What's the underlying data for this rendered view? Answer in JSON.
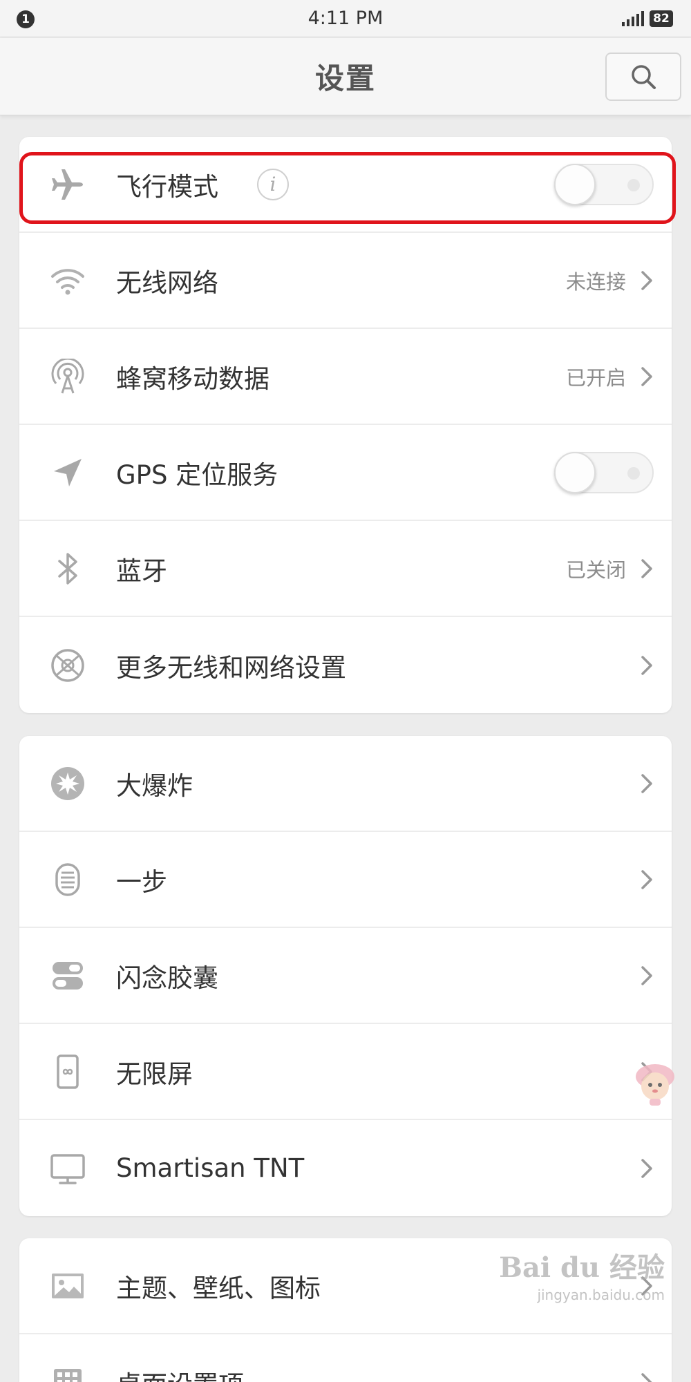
{
  "status_bar": {
    "notification_count": "1",
    "time": "4:11 PM",
    "battery": "82"
  },
  "header": {
    "title": "设置",
    "search_icon": "search-icon"
  },
  "sections": [
    {
      "items": [
        {
          "label": "飞行模式",
          "icon": "airplane-icon",
          "control": "toggle",
          "toggle_on": false,
          "has_info": true,
          "highlighted": true
        },
        {
          "label": "无线网络",
          "icon": "wifi-icon",
          "value": "未连接",
          "control": "chevron"
        },
        {
          "label": "蜂窝移动数据",
          "icon": "cellular-tower-icon",
          "value": "已开启",
          "control": "chevron"
        },
        {
          "label": "GPS 定位服务",
          "icon": "location-arrow-icon",
          "control": "toggle",
          "toggle_on": false
        },
        {
          "label": "蓝牙",
          "icon": "bluetooth-icon",
          "value": "已关闭",
          "control": "chevron"
        },
        {
          "label": "更多无线和网络设置",
          "icon": "network-globe-icon",
          "control": "chevron"
        }
      ]
    },
    {
      "items": [
        {
          "label": "大爆炸",
          "icon": "big-bang-icon",
          "control": "chevron"
        },
        {
          "label": "一步",
          "icon": "one-step-icon",
          "control": "chevron"
        },
        {
          "label": "闪念胶囊",
          "icon": "capsule-icon",
          "control": "chevron"
        },
        {
          "label": "无限屏",
          "icon": "phone-infinity-icon",
          "control": "chevron"
        },
        {
          "label": "Smartisan TNT",
          "icon": "monitor-icon",
          "control": "chevron"
        }
      ]
    },
    {
      "items": [
        {
          "label": "主题、壁纸、图标",
          "icon": "image-icon",
          "control": "chevron"
        },
        {
          "label": "桌面设置项",
          "icon": "grid-icon",
          "control": "chevron"
        }
      ]
    }
  ],
  "info_glyph": "i",
  "watermark": {
    "brand": "Bai du 经验",
    "url": "jingyan.baidu.com"
  },
  "colors": {
    "highlight": "#e0141b",
    "background": "#ececec",
    "card": "#ffffff"
  }
}
